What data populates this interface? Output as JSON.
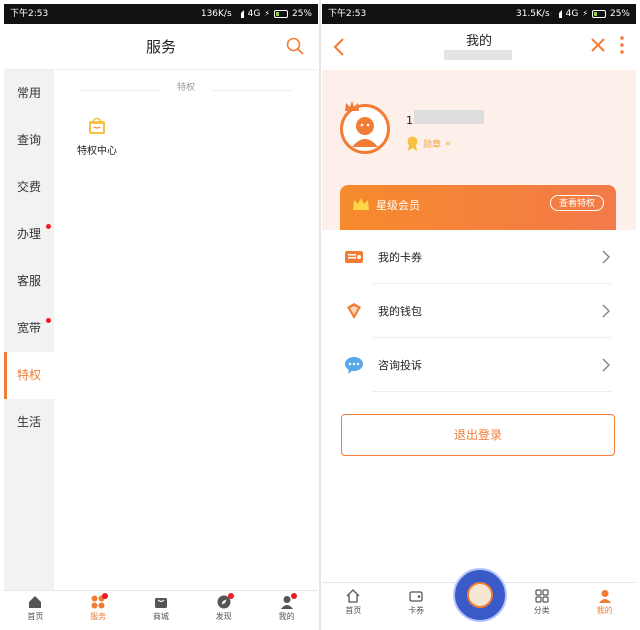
{
  "left": {
    "status": {
      "time": "下午2:53",
      "speed": "136K/s",
      "network": "4G",
      "battery": "25%"
    },
    "header": {
      "title": "服务"
    },
    "sidebar": [
      {
        "label": "常用",
        "dot": false,
        "active": false
      },
      {
        "label": "查询",
        "dot": false,
        "active": false
      },
      {
        "label": "交费",
        "dot": false,
        "active": false
      },
      {
        "label": "办理",
        "dot": true,
        "active": false
      },
      {
        "label": "客服",
        "dot": false,
        "active": false
      },
      {
        "label": "宽带",
        "dot": true,
        "active": false
      },
      {
        "label": "特权",
        "dot": false,
        "active": true
      },
      {
        "label": "生活",
        "dot": false,
        "active": false
      }
    ],
    "section_title": "特权",
    "privilege_center": "特权中心",
    "tabbar": [
      {
        "label": "首页",
        "icon": "home-icon",
        "dot": false,
        "active": false
      },
      {
        "label": "服务",
        "icon": "grid-icon",
        "dot": true,
        "active": true
      },
      {
        "label": "商城",
        "icon": "bag-icon",
        "dot": false,
        "active": false
      },
      {
        "label": "发现",
        "icon": "compass-icon",
        "dot": true,
        "active": false
      },
      {
        "label": "我的",
        "icon": "person-icon",
        "dot": true,
        "active": false
      }
    ]
  },
  "right": {
    "status": {
      "time": "下午2:53",
      "speed": "31.5K/s",
      "network": "4G",
      "battery": "25%"
    },
    "header": {
      "title": "我的"
    },
    "profile": {
      "username_prefix": "1",
      "badge_label": "勋章"
    },
    "member": {
      "label": "星级会员",
      "button": "查看特权"
    },
    "menu": [
      {
        "label": "我的卡券",
        "icon": "coupon-icon"
      },
      {
        "label": "我的钱包",
        "icon": "wallet-icon"
      },
      {
        "label": "咨询投诉",
        "icon": "chat-icon"
      }
    ],
    "logout": "退出登录",
    "tabbar": [
      {
        "label": "首页",
        "icon": "home-icon"
      },
      {
        "label": "卡券",
        "icon": "card-icon"
      },
      {
        "label": "",
        "icon": "center-orb-icon"
      },
      {
        "label": "分类",
        "icon": "category-icon"
      },
      {
        "label": "我的",
        "icon": "person-icon"
      }
    ]
  },
  "colors": {
    "accent": "#f37c34",
    "dot": "#ec1c24",
    "sidebar_bg": "#f2f2f2",
    "profile_bg": "#fdf0ea"
  }
}
